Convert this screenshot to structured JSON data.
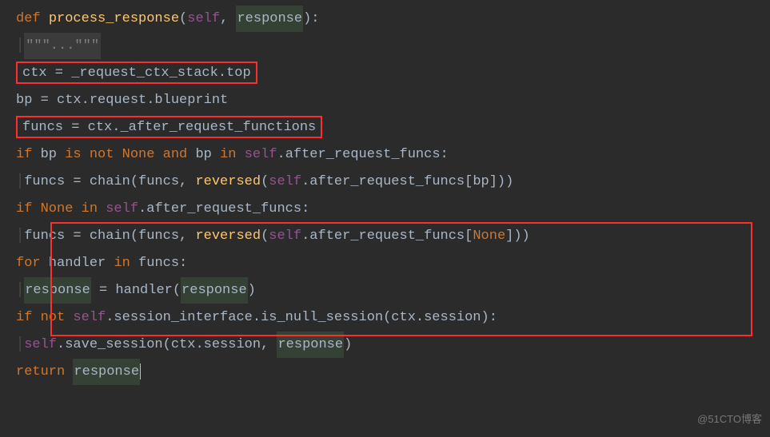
{
  "code": {
    "l1": {
      "def": "def",
      "fn": "process_response",
      "open": "(",
      "self": "self",
      "comma": ", ",
      "response": "response",
      "close": "):"
    },
    "l2": {
      "doc": "\"\"\"...\"\"\""
    },
    "l3": {
      "text": "ctx = _request_ctx_stack.top"
    },
    "l4": {
      "text": "bp = ctx.request.blueprint"
    },
    "l5": {
      "text": "funcs = ctx._after_request_functions"
    },
    "l6": {
      "if": "if",
      "a": " bp ",
      "is": "is not",
      "sp": " ",
      "none": "None",
      "b": " ",
      "and": "and",
      "c": " bp ",
      "in": "in",
      "sp2": " ",
      "self": "self",
      "d": ".after_request_funcs:"
    },
    "l7": {
      "a": "funcs = chain(funcs, ",
      "rev": "reversed",
      "b": "(",
      "self": "self",
      "c": ".after_request_funcs[bp]))"
    },
    "l8": {
      "if": "if",
      "sp": " ",
      "none": "None",
      "sp2": " ",
      "in": "in",
      "sp3": " ",
      "self": "self",
      "a": ".after_request_funcs:"
    },
    "l9": {
      "a": "funcs = chain(funcs, ",
      "rev": "reversed",
      "b": "(",
      "self": "self",
      "c": ".after_request_funcs[",
      "none": "None",
      "d": "]))"
    },
    "l10": {
      "for": "for",
      "a": " handler ",
      "in": "in",
      "b": " funcs:"
    },
    "l11": {
      "resp": "response",
      "a": " = handler(",
      "resp2": "response",
      "b": ")"
    },
    "l12": {
      "if": "if",
      "sp": " ",
      "not": "not",
      "sp2": " ",
      "self": "self",
      "a": ".session_interface.is_null_session(ctx.session):"
    },
    "l13": {
      "self": "self",
      "a": ".save_session(ctx.session, ",
      "resp": "response",
      "b": ")"
    },
    "l14": {
      "ret": "return",
      "sp": " ",
      "resp": "response"
    }
  },
  "watermark": "@51CTO博客"
}
